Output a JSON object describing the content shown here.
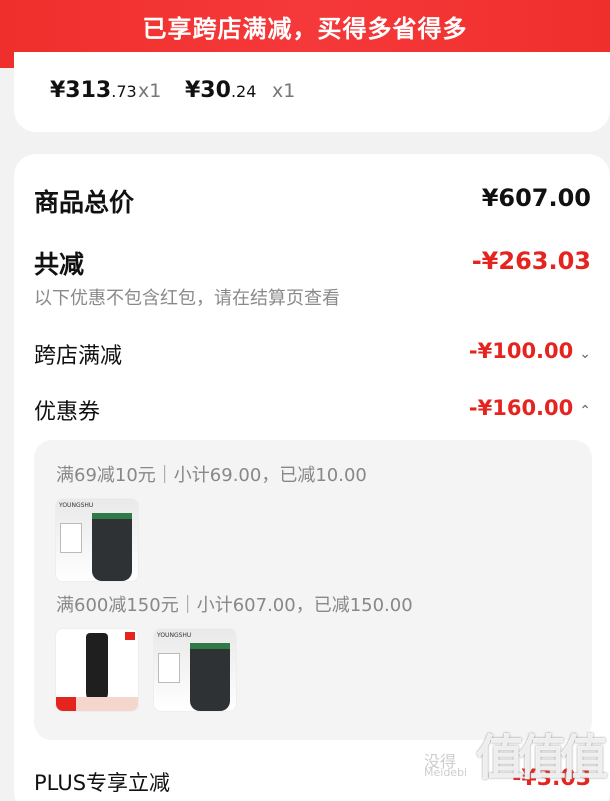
{
  "banner": {
    "text": "已享跨店满减，买得多省得多"
  },
  "items": [
    {
      "price_int": "¥313",
      "price_dec": ".73",
      "qty": "x1"
    },
    {
      "price_int": "¥30",
      "price_dec": ".24",
      "qty": "x1"
    }
  ],
  "summary": {
    "total_label": "商品总价",
    "total_value": "¥607.00",
    "discount_label": "共减",
    "discount_value": "-¥263.03",
    "discount_note": "以下优惠不包含红包，请在结算页查看",
    "cross_store_label": "跨店满减",
    "cross_store_value": "-¥100.00",
    "coupon_label": "优惠券",
    "coupon_value": "-¥160.00",
    "chev_down": "⌄",
    "chev_up": "⌃"
  },
  "coupons": [
    {
      "text": "满69减10元｜小计69.00，已减10.00"
    },
    {
      "text": "满600减150元｜小计607.00，已减150.00"
    }
  ],
  "product": {
    "brand": "YOUNGSHU"
  },
  "plus": {
    "label": "PLUS专享立减",
    "value": "-¥3.03"
  },
  "watermark": {
    "big": "值值值",
    "small1": "没得",
    "small2": "Meidebi"
  },
  "colors": {
    "accent_red": "#e5241f",
    "banner_red": "#f5383a"
  }
}
